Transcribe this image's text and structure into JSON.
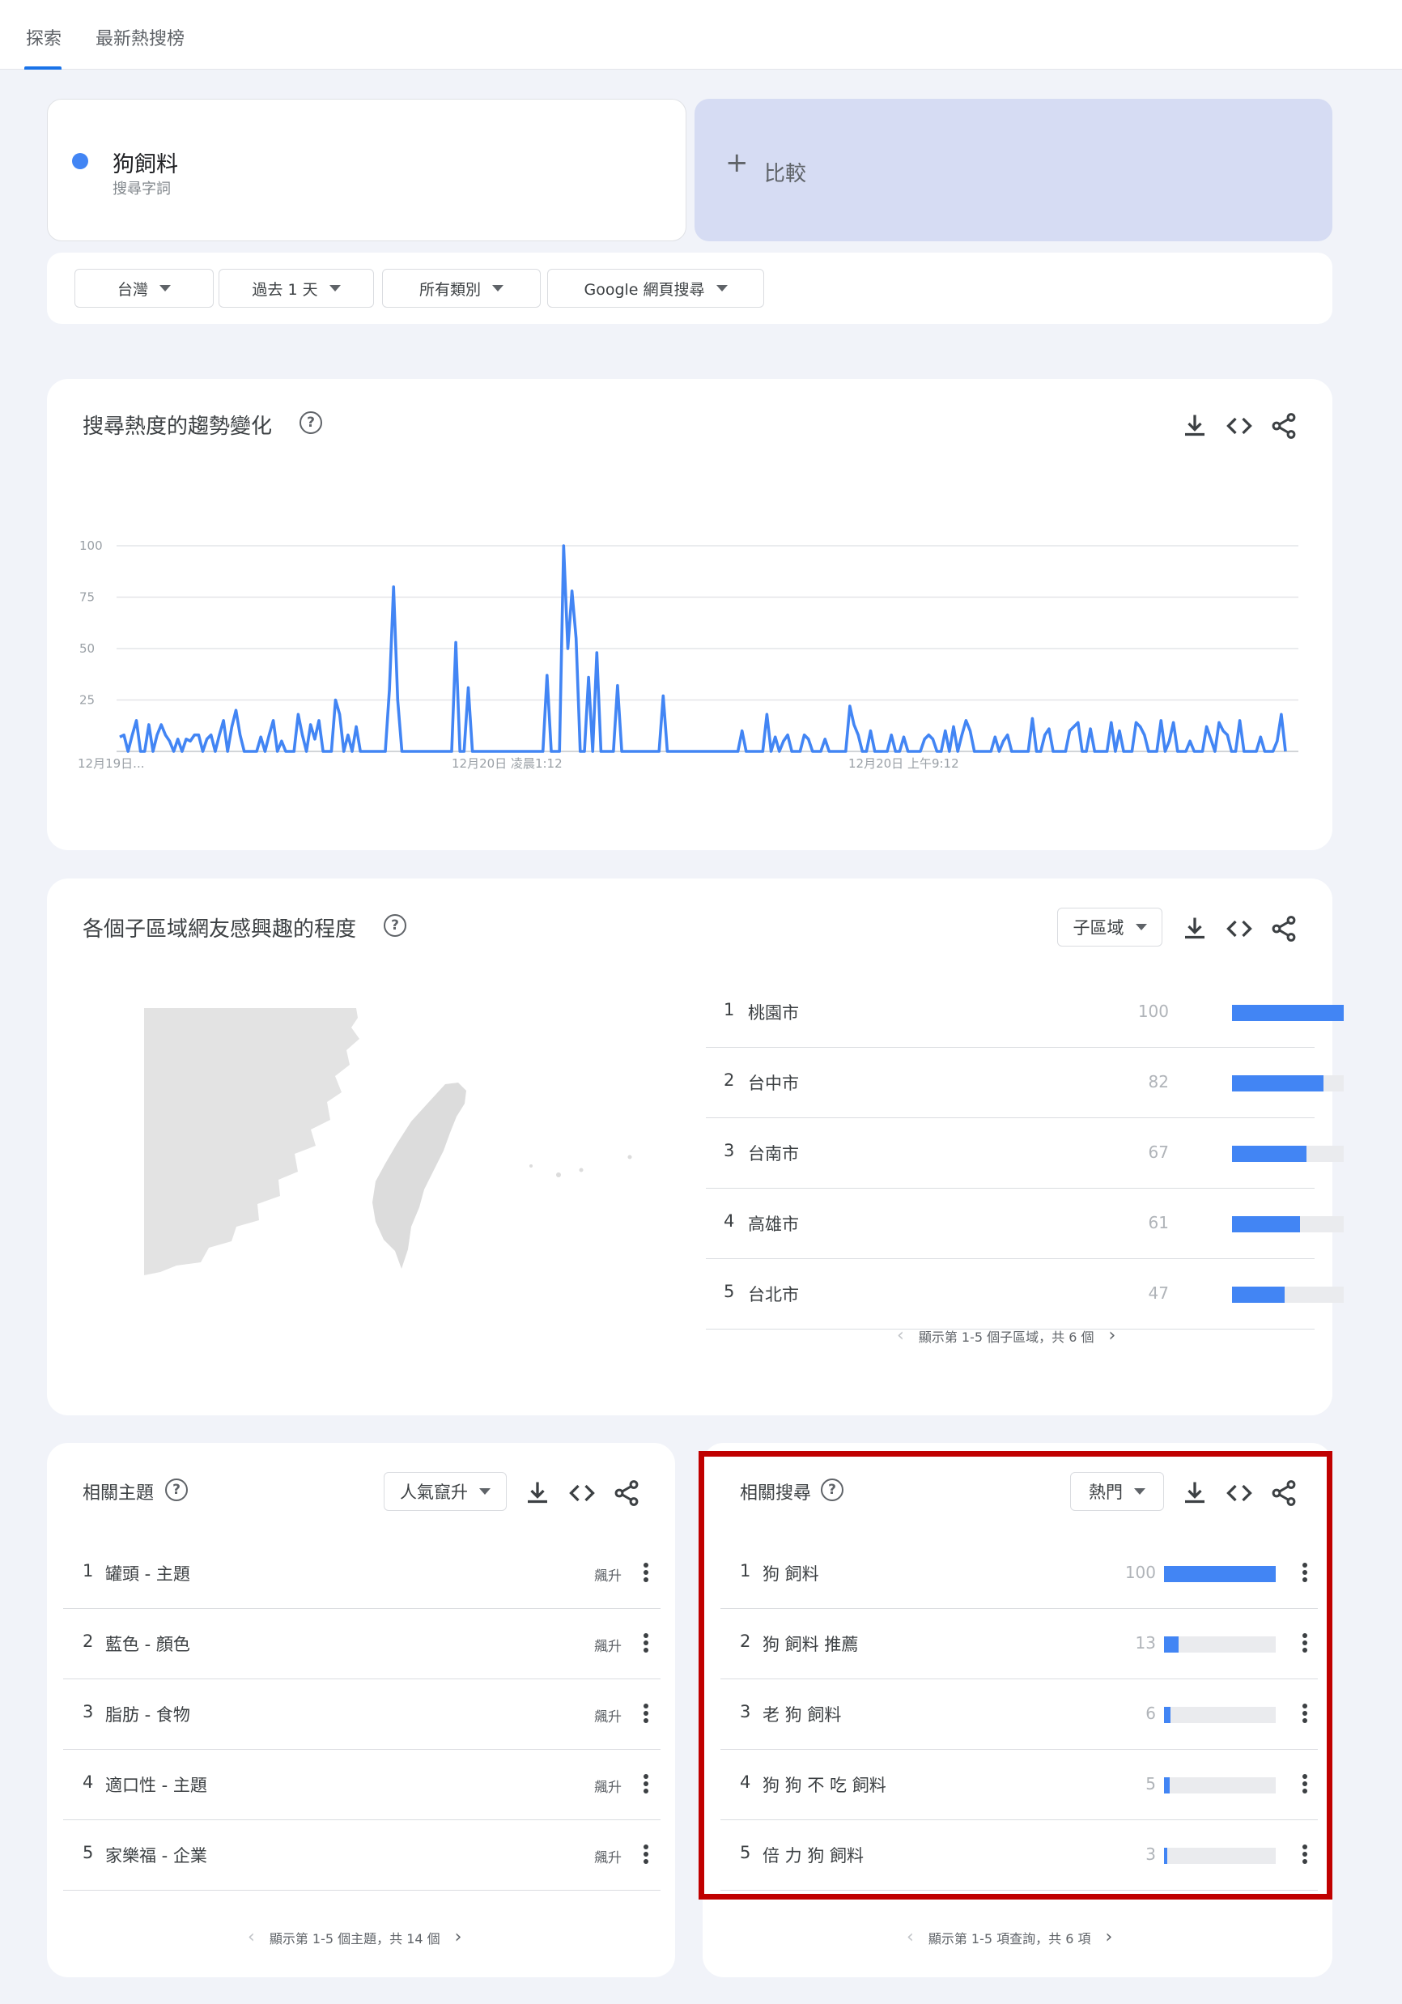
{
  "tabs": {
    "explore": "探索",
    "trending": "最新熱搜榜"
  },
  "search": {
    "term": "狗飼料",
    "term_type": "搜尋字詞",
    "term_color": "#4285f4",
    "compare_plus": "+",
    "compare_label": "比較"
  },
  "filters": {
    "region": "台灣",
    "time": "過去 1 天",
    "category": "所有類別",
    "property": "Google 網頁搜尋"
  },
  "trend": {
    "title": "搜尋熱度的趨勢變化",
    "help": "?",
    "chart_data": {
      "type": "line",
      "y_ticks": [
        "100",
        "75",
        "50",
        "25"
      ],
      "ylim": [
        0,
        100
      ],
      "x_labels": [
        "12月19日...",
        "12月20日 凌晨1:12",
        "12月20日 上午9:12"
      ],
      "grid": true,
      "series": [
        {
          "values": [
            7,
            8,
            0,
            8,
            15,
            0,
            0,
            13,
            0,
            8,
            13,
            8,
            5,
            0,
            6,
            0,
            6,
            5,
            8,
            8,
            0,
            6,
            8,
            0,
            8,
            15,
            0,
            12,
            20,
            8,
            0,
            0,
            0,
            0,
            7,
            0,
            8,
            15,
            0,
            5,
            0,
            0,
            0,
            18,
            8,
            0,
            13,
            6,
            15,
            0,
            0,
            0,
            25,
            18,
            0,
            8,
            0,
            12,
            0,
            0,
            0,
            0,
            0,
            0,
            0,
            30,
            80,
            25,
            0,
            0,
            0,
            0,
            0,
            0,
            0,
            0,
            0,
            0,
            0,
            0,
            0,
            53,
            0,
            0,
            31,
            0,
            0,
            0,
            0,
            0,
            0,
            0,
            0,
            0,
            0,
            0,
            0,
            0,
            0,
            0,
            0,
            0,
            0,
            37,
            0,
            0,
            0,
            100,
            50,
            78,
            55,
            0,
            0,
            36,
            0,
            48,
            0,
            0,
            0,
            0,
            32,
            0,
            0,
            0,
            0,
            0,
            0,
            0,
            0,
            0,
            0,
            27,
            0,
            0,
            0,
            0,
            0,
            0,
            0,
            0,
            0,
            0,
            0,
            0,
            0,
            0,
            0,
            0,
            0,
            0,
            10,
            0,
            0,
            0,
            0,
            0,
            18,
            0,
            7,
            0,
            5,
            8,
            0,
            0,
            0,
            8,
            6,
            0,
            0,
            0,
            6,
            0,
            0,
            0,
            0,
            0,
            22,
            13,
            8,
            0,
            0,
            10,
            0,
            0,
            0,
            0,
            8,
            0,
            0,
            7,
            0,
            0,
            0,
            0,
            6,
            8,
            6,
            0,
            0,
            10,
            0,
            12,
            0,
            8,
            15,
            10,
            0,
            0,
            0,
            0,
            0,
            7,
            0,
            5,
            8,
            0,
            0,
            0,
            0,
            0,
            16,
            0,
            0,
            8,
            11,
            0,
            0,
            0,
            0,
            10,
            12,
            14,
            0,
            0,
            11,
            0,
            0,
            0,
            0,
            14,
            0,
            10,
            0,
            0,
            0,
            14,
            12,
            8,
            0,
            0,
            0,
            15,
            0,
            5,
            14,
            0,
            0,
            0,
            5,
            0,
            0,
            0,
            12,
            6,
            0,
            14,
            10,
            8,
            0,
            0,
            15,
            0,
            0,
            0,
            0,
            7,
            0,
            0,
            0,
            5,
            18,
            0
          ]
        }
      ]
    }
  },
  "regions": {
    "title": "各個子區域網友感興趣的程度",
    "help": "?",
    "select_label": "子區域",
    "items": [
      {
        "rank": "1",
        "name": "桃園市",
        "value": 100
      },
      {
        "rank": "2",
        "name": "台中市",
        "value": 82
      },
      {
        "rank": "3",
        "name": "台南市",
        "value": 67
      },
      {
        "rank": "4",
        "name": "高雄市",
        "value": 61
      },
      {
        "rank": "5",
        "name": "台北市",
        "value": 47
      }
    ],
    "pager_text": "顯示第 1-5 個子區域，共 6 個"
  },
  "topics": {
    "title": "相關主題",
    "help": "?",
    "select_label": "人氣竄升",
    "items": [
      {
        "rank": "1",
        "name": "罐頭 - 主題",
        "status": "飆升"
      },
      {
        "rank": "2",
        "name": "藍色 - 顏色",
        "status": "飆升"
      },
      {
        "rank": "3",
        "name": "脂肪 - 食物",
        "status": "飆升"
      },
      {
        "rank": "4",
        "name": "適口性 - 主題",
        "status": "飆升"
      },
      {
        "rank": "5",
        "name": "家樂福 - 企業",
        "status": "飆升"
      }
    ],
    "pager_text": "顯示第 1-5 個主題，共 14 個"
  },
  "queries": {
    "title": "相關搜尋",
    "help": "?",
    "select_label": "熱門",
    "items": [
      {
        "rank": "1",
        "name": "狗 飼料",
        "value": 100
      },
      {
        "rank": "2",
        "name": "狗 飼料 推薦",
        "value": 13
      },
      {
        "rank": "3",
        "name": "老 狗 飼料",
        "value": 6
      },
      {
        "rank": "4",
        "name": "狗 狗 不 吃 飼料",
        "value": 5
      },
      {
        "rank": "5",
        "name": "倍 力 狗 飼料",
        "value": 3
      }
    ],
    "pager_text": "顯示第 1-5 項查詢，共 6 項"
  },
  "pager_prev": "‹",
  "pager_next": "›"
}
